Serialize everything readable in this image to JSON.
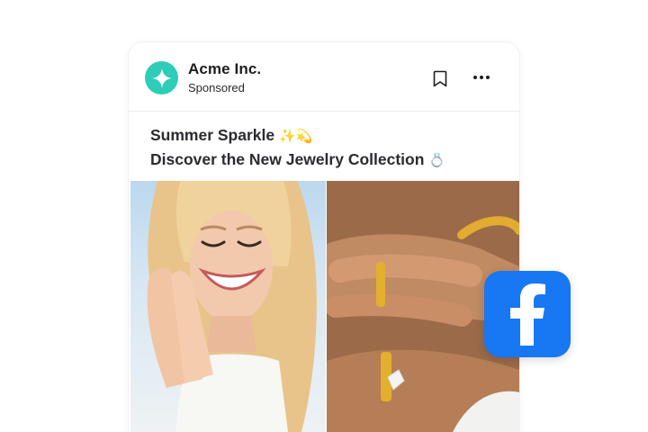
{
  "post": {
    "brand_name": "Acme Inc.",
    "sponsored_label": "Sponsored",
    "caption_line1": "Summer Sparkle",
    "caption_line1_emoji": "✨💫",
    "caption_line2": "Discover the New Jewelry Collection",
    "caption_line2_emoji": "💍"
  },
  "icons": {
    "avatar": "sparkle-icon",
    "save": "bookmark-icon",
    "more": "more-options-icon",
    "platform": "facebook-icon"
  },
  "colors": {
    "avatar_bg": "#2dcdb8",
    "facebook_blue": "#1877f2",
    "text_primary": "#1d1d1f"
  }
}
